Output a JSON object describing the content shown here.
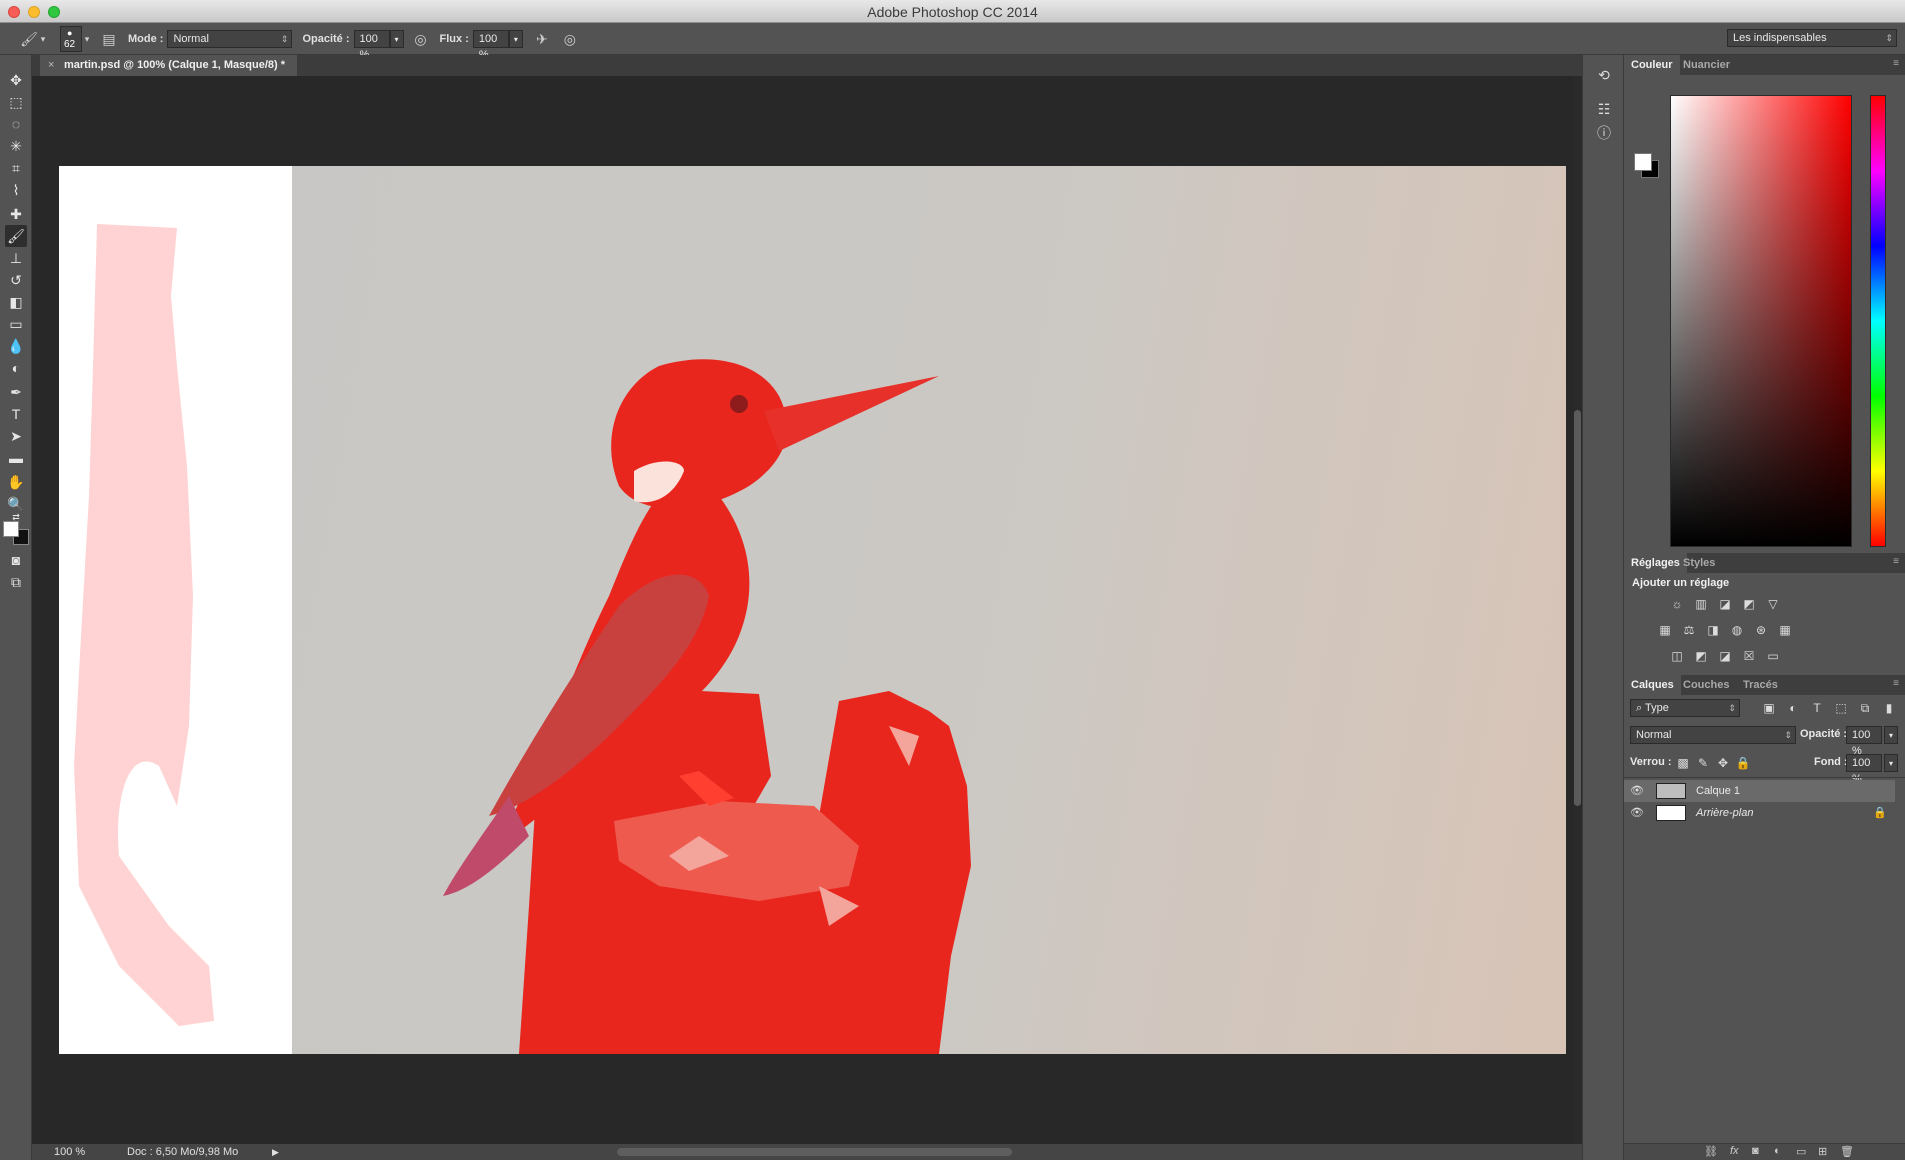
{
  "window": {
    "title": "Adobe Photoshop CC 2014"
  },
  "options_bar": {
    "brush_size": "62",
    "mode_label": "Mode :",
    "mode_value": "Normal",
    "opacity_label": "Opacité :",
    "opacity_value": "100 %",
    "flow_label": "Flux :",
    "flow_value": "100 %",
    "workspace": "Les indispensables"
  },
  "document": {
    "tab_title": "martin.psd @ 100% (Calque 1, Masque/8) *",
    "close_glyph": "×"
  },
  "status": {
    "zoom": "100 %",
    "doc_info": "Doc : 6,50 Mo/9,98 Mo",
    "play_glyph": "▶"
  },
  "panels": {
    "color_tabs": [
      "Couleur",
      "Nuancier"
    ],
    "adjust_tabs": [
      "Réglages",
      "Styles"
    ],
    "adjust_title": "Ajouter un réglage",
    "layers_tabs": [
      "Calques",
      "Couches",
      "Tracés"
    ],
    "filter_kind": "Type",
    "blend_mode": "Normal",
    "opacity_label": "Opacité :",
    "opacity_value": "100 %",
    "lock_label": "Verrou :",
    "fill_label": "Fond :",
    "fill_value": "100 %",
    "layers": [
      {
        "name": "Calque 1",
        "selected": true,
        "locked": false
      },
      {
        "name": "Arrière-plan",
        "selected": false,
        "locked": true
      }
    ],
    "footer_icons": [
      "link-icon",
      "fx-icon",
      "mask-icon",
      "adjustment-icon",
      "folder-icon",
      "new-layer-icon",
      "trash-icon"
    ]
  },
  "colors": {
    "mask_overlay": "#e8261e",
    "foreground": "#ffffff",
    "background": "#000000"
  }
}
